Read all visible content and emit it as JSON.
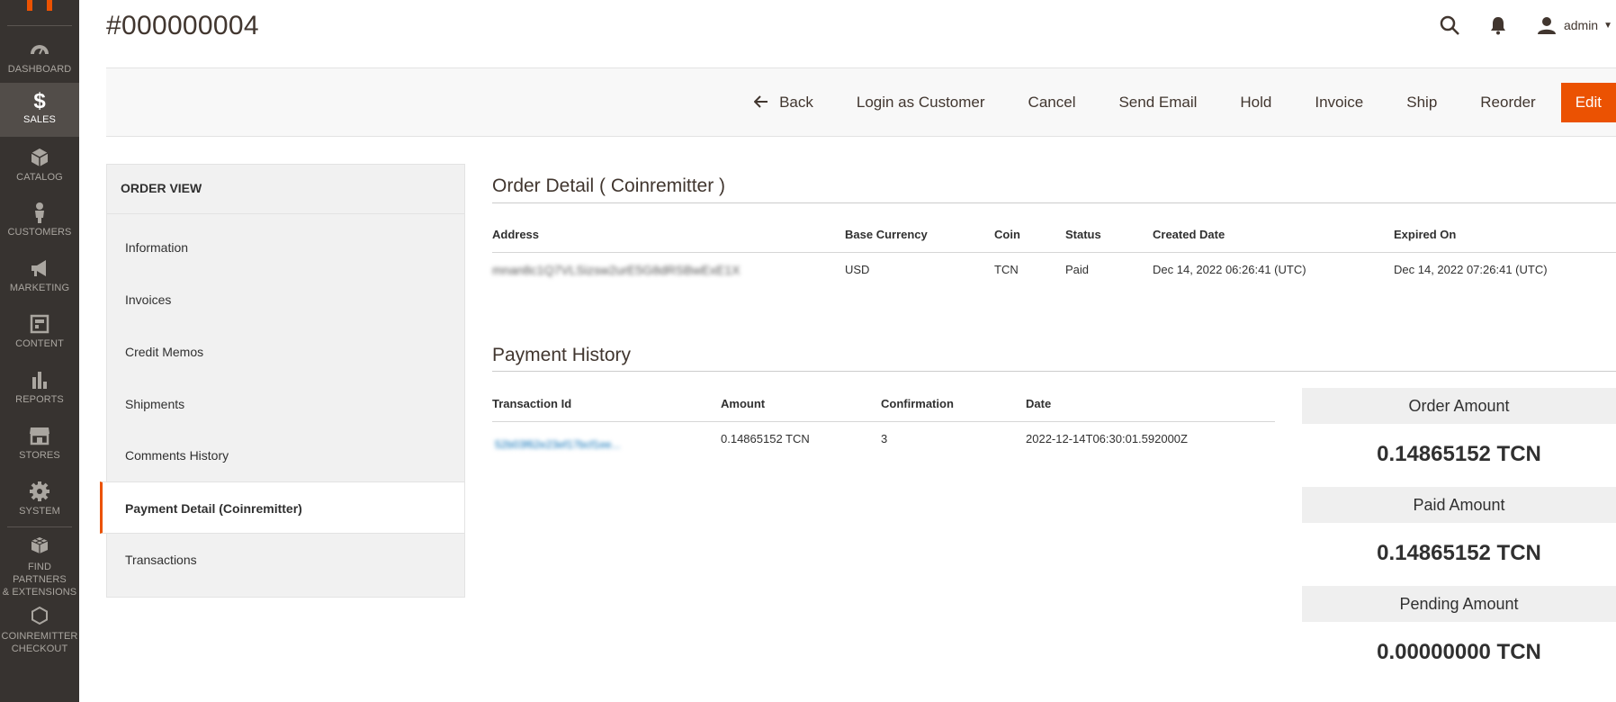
{
  "sidebar": {
    "items": [
      {
        "label": "DASHBOARD",
        "icon": "dashboard-icon"
      },
      {
        "label": "SALES",
        "icon": "dollar-icon"
      },
      {
        "label": "CATALOG",
        "icon": "box-icon"
      },
      {
        "label": "CUSTOMERS",
        "icon": "person-icon"
      },
      {
        "label": "MARKETING",
        "icon": "megaphone-icon"
      },
      {
        "label": "CONTENT",
        "icon": "layout-icon"
      },
      {
        "label": "REPORTS",
        "icon": "bar-chart-icon"
      },
      {
        "label": "STORES",
        "icon": "storefront-icon"
      },
      {
        "label": "SYSTEM",
        "icon": "gear-icon"
      },
      {
        "label_line1": "FIND PARTNERS",
        "label_line2": "& EXTENSIONS",
        "icon": "cubes-icon"
      },
      {
        "label_line1": "COINREMITTER",
        "label_line2": "CHECKOUT",
        "icon": "hexagon-icon"
      }
    ],
    "active": "SALES"
  },
  "header": {
    "title": "#000000004",
    "user": "admin"
  },
  "actions": {
    "back": "Back",
    "login_as_customer": "Login as Customer",
    "cancel": "Cancel",
    "send_email": "Send Email",
    "hold": "Hold",
    "invoice": "Invoice",
    "ship": "Ship",
    "reorder": "Reorder",
    "edit": "Edit"
  },
  "order_view": {
    "title": "ORDER VIEW",
    "tabs": [
      {
        "label": "Information"
      },
      {
        "label": "Invoices"
      },
      {
        "label": "Credit Memos"
      },
      {
        "label": "Shipments"
      },
      {
        "label": "Comments History"
      },
      {
        "label": "Payment Detail (Coinremitter)"
      },
      {
        "label": "Transactions"
      }
    ],
    "active_tab": "Payment Detail (Coinremitter)"
  },
  "order_detail": {
    "title": "Order Detail ( Coinremitter )",
    "headers": {
      "address": "Address",
      "base_currency": "Base Currency",
      "coin": "Coin",
      "status": "Status",
      "created": "Created Date",
      "expired": "Expired On"
    },
    "row": {
      "address": "mnan8c1Q7VLSizsw2urE5G8dRSBwExE1X",
      "base_currency": "USD",
      "coin": "TCN",
      "status": "Paid",
      "created": "Dec 14, 2022 06:26:41 (UTC)",
      "expired": "Dec 14, 2022 07:26:41 (UTC)"
    }
  },
  "payment_history": {
    "title": "Payment History",
    "headers": {
      "txid": "Transaction Id",
      "amount": "Amount",
      "confirmation": "Confirmation",
      "date": "Date"
    },
    "row": {
      "txid": "52b03f62e23ef17bcf1ee...",
      "amount": "0.14865152 TCN",
      "confirmation": "3",
      "date": "2022-12-14T06:30:01.592000Z"
    }
  },
  "summary": {
    "order_amount_label": "Order Amount",
    "order_amount": "0.14865152 TCN",
    "paid_amount_label": "Paid Amount",
    "paid_amount": "0.14865152 TCN",
    "pending_amount_label": "Pending Amount",
    "pending_amount": "0.00000000 TCN"
  },
  "colors": {
    "sidebar_bg": "#373330",
    "accent": "#eb5202",
    "link": "#006bb4"
  }
}
